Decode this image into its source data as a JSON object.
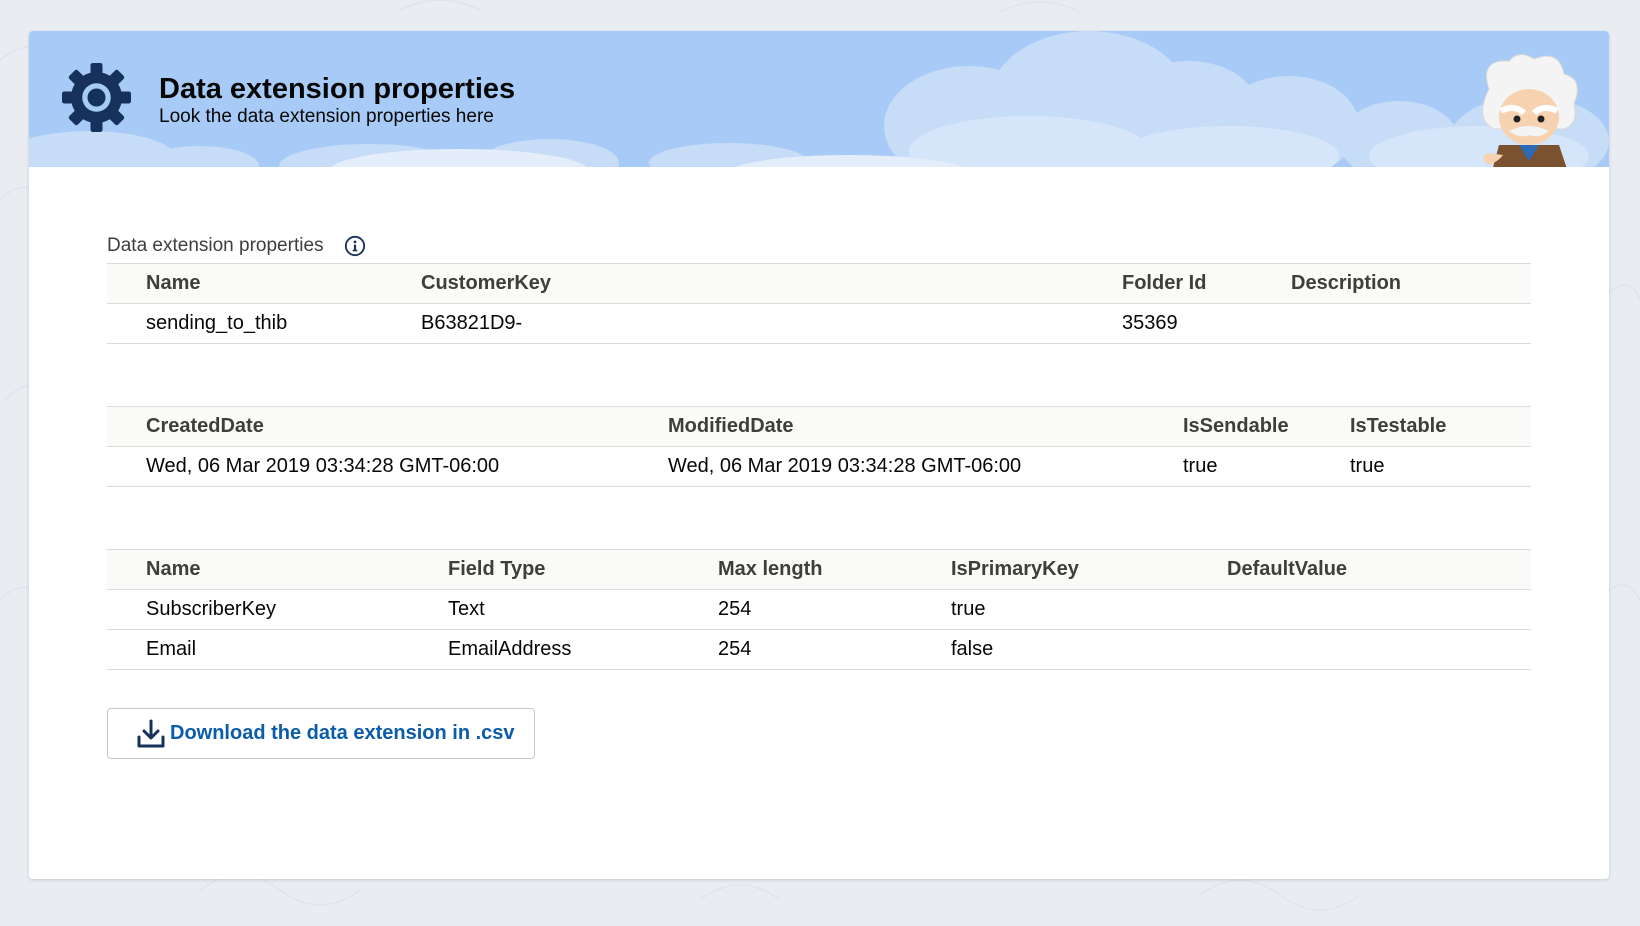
{
  "header": {
    "title": "Data extension properties",
    "subtitle": "Look the data extension properties here",
    "icon": "gear-icon",
    "mascot": "einstein-mascot"
  },
  "section": {
    "label": "Data extension properties",
    "info_icon": "info-icon"
  },
  "properties_table": {
    "columns": [
      "Name",
      "CustomerKey",
      "Folder Id",
      "Description"
    ],
    "rows": [
      [
        "sending_to_thib",
        "B63821D9-",
        "35369",
        ""
      ]
    ]
  },
  "dates_table": {
    "columns": [
      "CreatedDate",
      "ModifiedDate",
      "IsSendable",
      "IsTestable"
    ],
    "rows": [
      [
        "Wed, 06 Mar 2019 03:34:28 GMT-06:00",
        "Wed, 06 Mar 2019 03:34:28 GMT-06:00",
        "true",
        "true"
      ]
    ]
  },
  "fields_table": {
    "columns": [
      "Name",
      "Field Type",
      "Max length",
      "IsPrimaryKey",
      "DefaultValue"
    ],
    "rows": [
      [
        "SubscriberKey",
        "Text",
        "254",
        "true",
        ""
      ],
      [
        "Email",
        "EmailAddress",
        "254",
        "false",
        ""
      ]
    ]
  },
  "download": {
    "label": "Download the data extension in .csv",
    "icon": "download-icon"
  },
  "colors": {
    "header_sky": "#a7cbf6",
    "header_icon": "#16325c",
    "link": "#0b5cab",
    "page_bg": "#e9edf2"
  }
}
